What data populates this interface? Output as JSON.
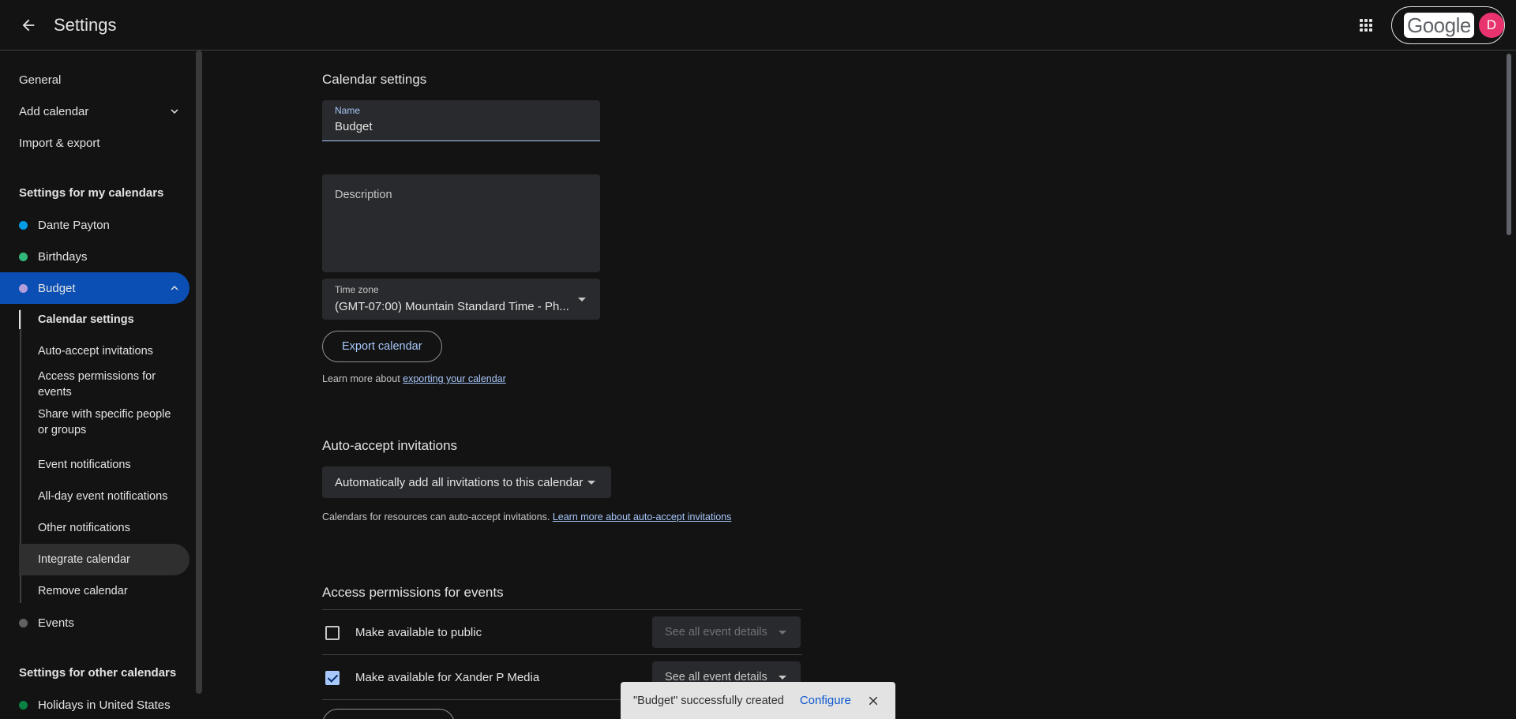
{
  "header": {
    "title": "Settings",
    "google_logo": "Google",
    "avatar_letter": "D",
    "avatar_color": "#e8336f"
  },
  "sidebar": {
    "general": "General",
    "add_calendar": "Add calendar",
    "import_export": "Import & export",
    "my_calendars_heading": "Settings for my calendars",
    "my_calendars": [
      {
        "label": "Dante Payton",
        "color": "#039be5"
      },
      {
        "label": "Birthdays",
        "color": "#33b679"
      },
      {
        "label": "Budget",
        "color": "#b39ddb"
      }
    ],
    "sub_items": [
      "Calendar settings",
      "Auto-accept invitations",
      "Access permissions for events",
      "Share with specific people or groups",
      "Event notifications",
      "All-day event notifications",
      "Other notifications",
      "Integrate calendar",
      "Remove calendar"
    ],
    "events": {
      "label": "Events",
      "color": "#616161"
    },
    "other_calendars_heading": "Settings for other calendars",
    "other_calendars": [
      {
        "label": "Holidays in United States",
        "color": "#0b8043"
      }
    ]
  },
  "calendar_settings": {
    "heading": "Calendar settings",
    "name_label": "Name",
    "name_value": "Budget",
    "description_label": "Description",
    "timezone_label": "Time zone",
    "timezone_value": "(GMT-07:00) Mountain Standard Time - Ph...",
    "export_button": "Export calendar",
    "export_help_prefix": "Learn more about ",
    "export_help_link": "exporting your calendar"
  },
  "auto_accept": {
    "heading": "Auto-accept invitations",
    "select_value": "Automatically add all invitations to this calendar",
    "help_prefix": "Calendars for resources can auto-accept invitations. ",
    "help_link": "Learn more about auto-accept invitations"
  },
  "access_permissions": {
    "heading": "Access permissions for events",
    "rows": [
      {
        "label": "Make available to public",
        "checked": false,
        "select": "See all event details"
      },
      {
        "label": "Make available for Xander P Media",
        "checked": true,
        "select": "See all event details"
      }
    ]
  },
  "snackbar": {
    "text": "\"Budget\" successfully created",
    "action": "Configure"
  }
}
